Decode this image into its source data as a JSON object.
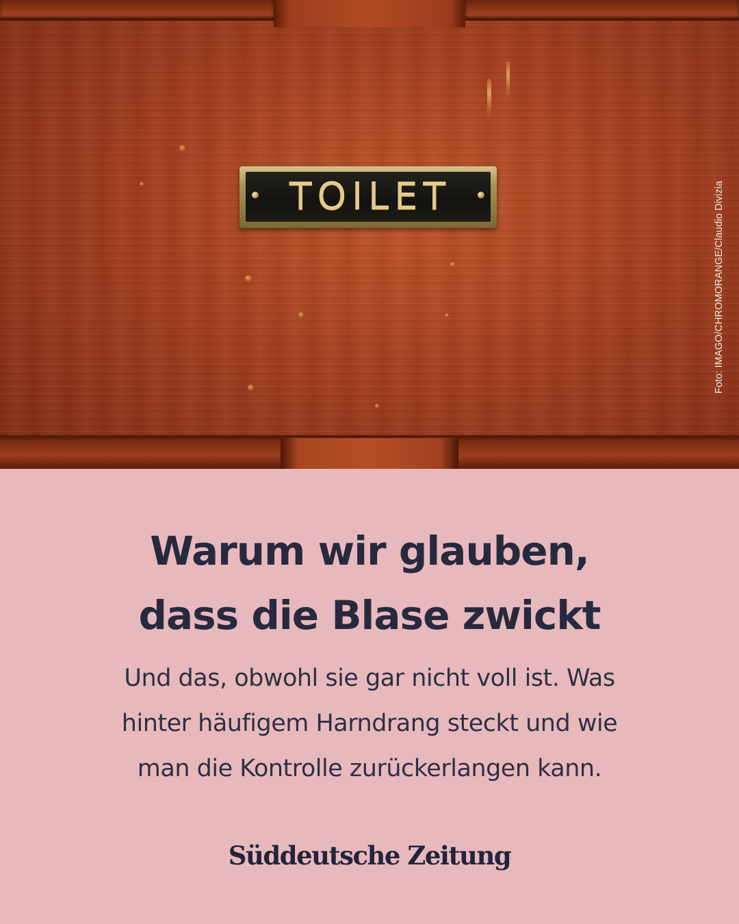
{
  "photo": {
    "sign_text": "TOILET",
    "credit": "Foto: IMAGO/CHROMORANGE/Claudio Divizia"
  },
  "headline": {
    "line1": "Warum wir glauben,",
    "line2": "dass die Blase zwickt"
  },
  "subline": {
    "line1": "Und das, obwohl sie gar nicht voll ist. Was",
    "line2": "hinter häufigem Harndrang steckt und wie",
    "line3": "man die Kontrolle zurückerlangen kann."
  },
  "brand": {
    "logo_text": "Süddeutsche Zeitung"
  },
  "colors": {
    "background": "#e8b9bc",
    "text": "#272a3f",
    "wood": "#a63f1e",
    "brass": "#e6c987"
  }
}
